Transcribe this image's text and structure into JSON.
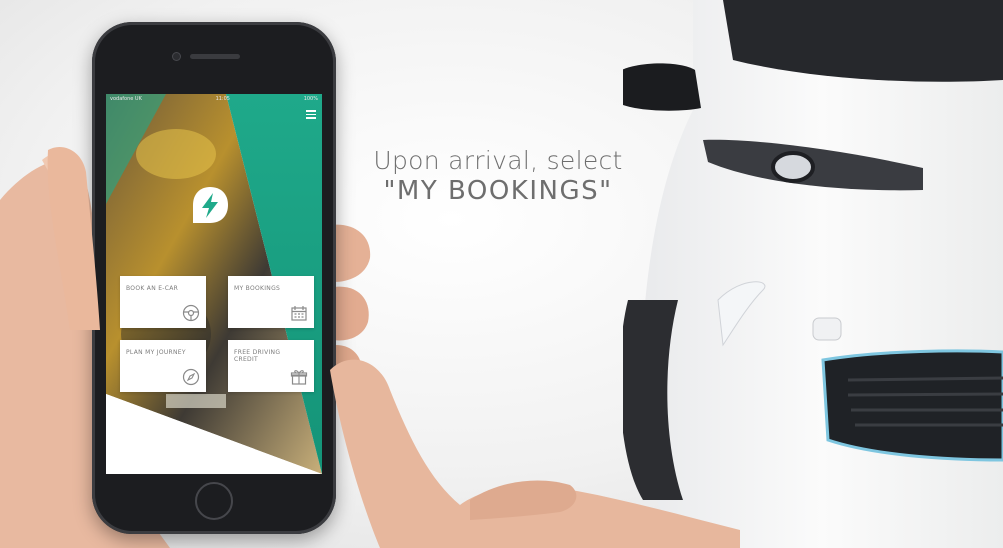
{
  "caption": {
    "line1": "Upon arrival, select",
    "line2": "\"MY BOOKINGS\""
  },
  "app": {
    "status_bar": {
      "carrier": "vodafone UK",
      "time": "11:05",
      "battery": "100%"
    },
    "tiles": [
      {
        "label": "BOOK AN E-CAR",
        "icon": "steering-wheel-icon"
      },
      {
        "label": "MY BOOKINGS",
        "icon": "calendar-icon"
      },
      {
        "label": "PLAN MY JOURNEY",
        "icon": "compass-icon"
      },
      {
        "label": "FREE DRIVING CREDIT",
        "icon": "gift-icon"
      }
    ],
    "colors": {
      "brand_green": "#1fa98a",
      "tile_bg": "#ffffff",
      "tile_text": "#7c7c7c"
    }
  }
}
